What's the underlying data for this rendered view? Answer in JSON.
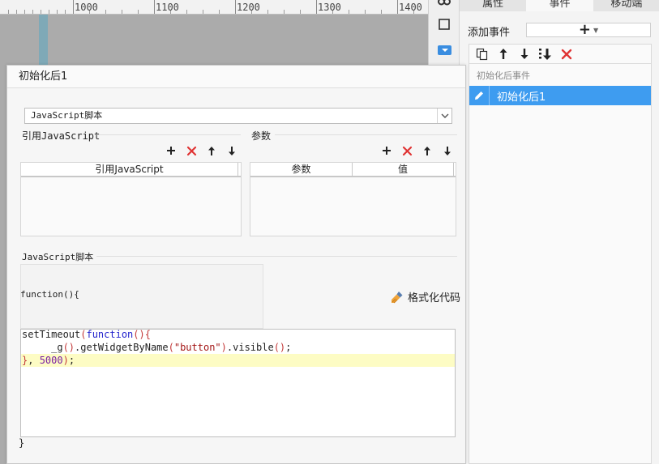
{
  "ruler": {
    "labels": [
      "1000",
      "1100",
      "1200",
      "1300",
      "1400"
    ]
  },
  "right_panel": {
    "tabs": [
      "属性",
      "事件",
      "移动端"
    ],
    "active_tab": "事件",
    "add_event_label": "添加事件",
    "add_icon": "plus-icon",
    "event_group_label": "初始化后事件",
    "selected_event": "初始化后1",
    "toolbar_icons": [
      "copy-icon",
      "move-up-icon",
      "move-down-icon",
      "move-bottom-icon",
      "delete-icon"
    ]
  },
  "dialog": {
    "title": "初始化后1",
    "script_type": "JavaScript脚本",
    "ref_section_title": "引用JavaScript",
    "params_section_title": "参数",
    "ref_column": "引用JavaScript",
    "param_columns": [
      "参数",
      "值"
    ],
    "script_section_title": "JavaScript脚本",
    "function_header": "function(){",
    "format_button": "格式化代码",
    "closing_brace": "}",
    "code_lines": [
      "setTimeout(function(){",
      "    _g().getWidgetByName(\"button\").visible();",
      "}, 5000);"
    ],
    "highlighted_line": 3
  },
  "colors": {
    "accent_blue": "#3e9cf0",
    "delete_red": "#e03434",
    "line_highlight": "#fdfcc4"
  }
}
